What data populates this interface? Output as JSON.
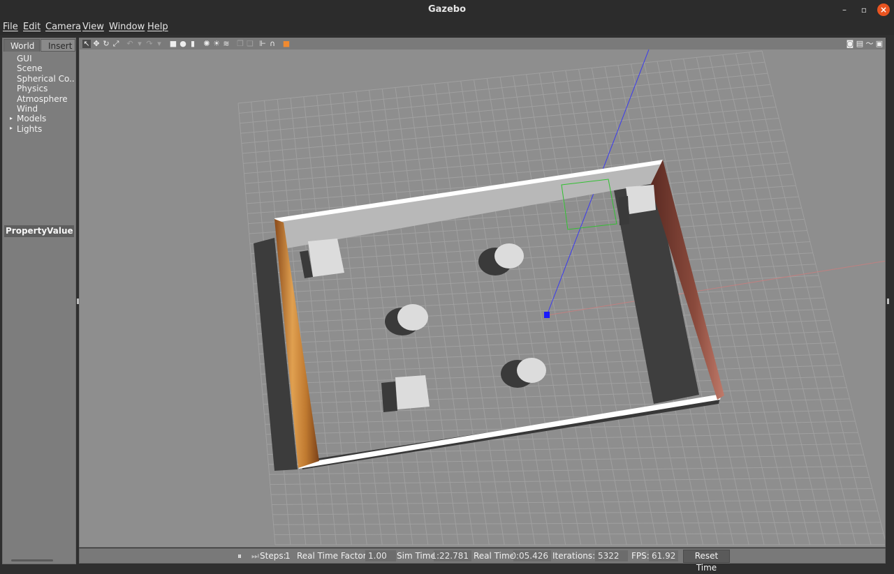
{
  "window": {
    "title": "Gazebo",
    "minimize": "–",
    "maximize": "▫",
    "close": "×"
  },
  "menu": [
    "File",
    "Edit",
    "Camera",
    "View",
    "Window",
    "Help"
  ],
  "left_panel": {
    "tabs": {
      "world": "World",
      "insert": "Insert"
    },
    "tree": [
      {
        "label": "GUI",
        "expandable": false
      },
      {
        "label": "Scene",
        "expandable": false
      },
      {
        "label": "Spherical Co...",
        "expandable": false
      },
      {
        "label": "Physics",
        "expandable": false
      },
      {
        "label": "Atmosphere",
        "expandable": false
      },
      {
        "label": "Wind",
        "expandable": false
      },
      {
        "label": "Models",
        "expandable": true
      },
      {
        "label": "Lights",
        "expandable": true
      }
    ],
    "property_header": "PropertyValue"
  },
  "toolbar": {
    "icons": [
      "select-arrow-icon",
      "translate-icon",
      "rotate-icon",
      "scale-icon",
      "undo-icon",
      "redo-icon",
      "box-icon",
      "sphere-icon",
      "cylinder-icon",
      "point-light-icon",
      "spot-light-icon",
      "directional-light-icon",
      "copy-icon",
      "paste-icon",
      "align-icon",
      "snap-icon",
      "change-view-icon"
    ],
    "right_icons": [
      "screenshot-icon",
      "log-icon",
      "plot-icon",
      "video-icon"
    ]
  },
  "status_bar": {
    "pause_icon": "⏸",
    "step_icon": "⏭",
    "steps_label": "Steps:",
    "steps_value": "1",
    "rtf_label": "Real Time Factor:",
    "rtf_value": "1.00",
    "sim_time_label": "Sim Time:",
    "sim_time_value": "1:22.781",
    "real_time_label": "Real Time:",
    "real_time_value": "0:05.426",
    "iterations_label": "Iterations:",
    "iterations_value": "5322",
    "fps_label": "FPS:",
    "fps_value": "61.92",
    "reset_label": "Reset Time"
  },
  "colors": {
    "background": "#8e8e8e",
    "grid": "#9a9a9a",
    "wall_gray": "#b0b0b0",
    "wall_wood": "#d08a3c",
    "wall_brick": "#8a4a3c",
    "accent": "#e95420"
  }
}
